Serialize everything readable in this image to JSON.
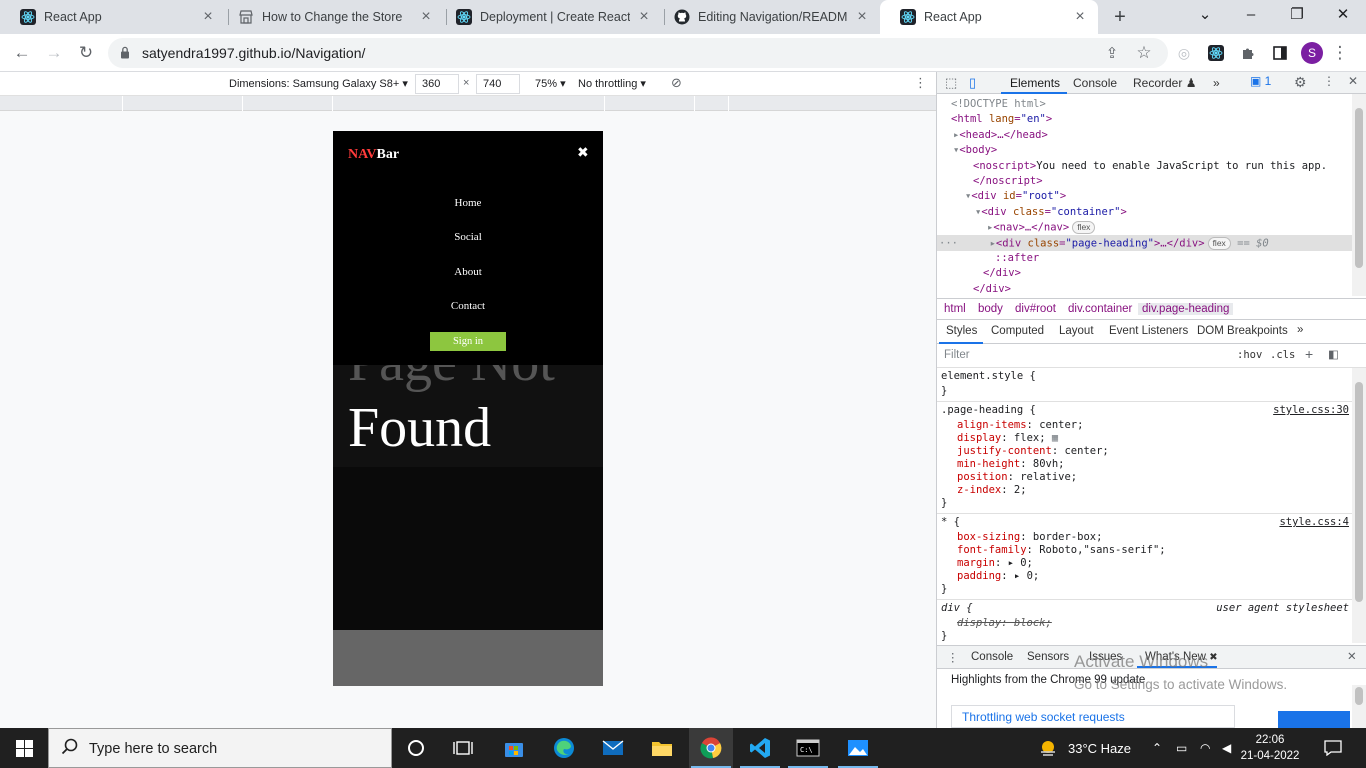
{
  "browser": {
    "tabs": [
      {
        "title": "React App",
        "icon": "react-icon"
      },
      {
        "title": "How to Change the Store",
        "icon": "store-icon"
      },
      {
        "title": "Deployment | Create React A",
        "icon": "react-icon"
      },
      {
        "title": "Editing Navigation/README.",
        "icon": "github-icon"
      },
      {
        "title": "React App",
        "icon": "react-icon",
        "active": true
      }
    ],
    "url": "satyendra1997.github.io/Navigation/",
    "profile_initial": "S"
  },
  "device_toolbar": {
    "dimensions_label": "Dimensions: Samsung Galaxy S8+",
    "width": "360",
    "times": "×",
    "height": "740",
    "zoom": "75%",
    "throttling": "No throttling"
  },
  "site": {
    "brand_accent": "NAV",
    "brand_rest": "Bar",
    "close_glyph": "✖",
    "menu": [
      "Home",
      "Social",
      "About",
      "Contact"
    ],
    "signin": "Sign in",
    "heading_line1": "Page Not",
    "heading_line2": "Found"
  },
  "devtools": {
    "tabs": [
      "Elements",
      "Console",
      "Recorder",
      "»"
    ],
    "issues_count": "1",
    "dom": {
      "doctype": "<!DOCTYPE html>",
      "html_open_tag": "html",
      "lang_attr": "lang",
      "lang_val": "\"en\"",
      "head": "<head>…</head>",
      "body": "<body>",
      "noscript_open": "<noscript>",
      "noscript_text": "You need to enable JavaScript to run this app.",
      "noscript_close": "</noscript>",
      "root_tag": "div",
      "id_attr": "id",
      "root_val": "\"root\"",
      "container_tag": "div",
      "class_attr": "class",
      "container_val": "\"container\"",
      "nav": "<nav>…</nav>",
      "flex": "flex",
      "heading_tag": "div",
      "heading_val": "\"page-heading\"",
      "heading_end": ">…</div>",
      "eq": "== $0",
      "after": "::after",
      "div_close": "</div>",
      "div_close2": "</div>"
    },
    "crumbs": [
      "html",
      "body",
      "div#root",
      "div.container",
      "div.page-heading"
    ],
    "sub_tabs": [
      "Styles",
      "Computed",
      "Layout",
      "Event Listeners",
      "DOM Breakpoints",
      "»"
    ],
    "filter_placeholder": "Filter",
    "hov": ":hov",
    "cls": ".cls",
    "styles": {
      "element_style": "element.style {",
      "close": "}",
      "rule1_selector": ".page-heading {",
      "rule1_src": "style.css:30",
      "rule1_props": [
        {
          "p": "align-items",
          "v": "center;"
        },
        {
          "p": "display",
          "v": "flex;"
        },
        {
          "p": "justify-content",
          "v": "center;"
        },
        {
          "p": "min-height",
          "v": "80vh;"
        },
        {
          "p": "position",
          "v": "relative;"
        },
        {
          "p": "z-index",
          "v": "2;"
        }
      ],
      "rule2_selector": "* {",
      "rule2_src": "style.css:4",
      "rule2_props": [
        {
          "p": "box-sizing",
          "v": "border-box;"
        },
        {
          "p": "font-family",
          "v": "Roboto,\"sans-serif\";"
        },
        {
          "p": "margin",
          "v": "▸ 0;"
        },
        {
          "p": "padding",
          "v": "▸ 0;"
        }
      ],
      "rule3_selector": "div {",
      "rule3_src": "user agent stylesheet",
      "rule3_prop": "display: block;"
    },
    "drawer_tabs": [
      "Console",
      "Sensors",
      "Issues",
      "What's New"
    ],
    "drawer_headline": "Highlights from the Chrome 99 update",
    "drawer_link": "Throttling web socket requests",
    "watermark_title": "Activate Windows",
    "watermark_sub": "Go to Settings to activate Windows."
  },
  "taskbar": {
    "search_placeholder": "Type here to search",
    "weather": "33°C  Haze",
    "time": "22:06",
    "date": "21-04-2022"
  },
  "colors": {
    "accent_blue": "#1a73e8",
    "signin_green": "#8dc63f",
    "brand_red": "#ff3b3b"
  }
}
